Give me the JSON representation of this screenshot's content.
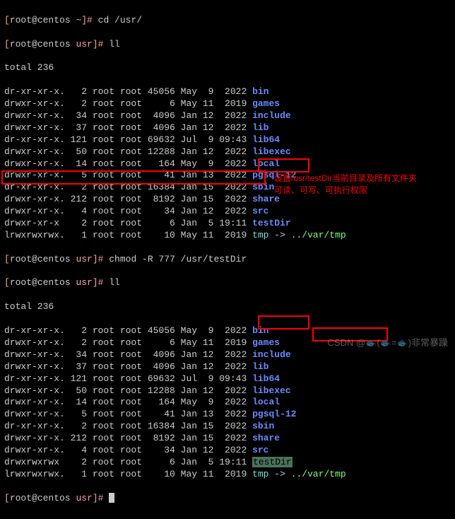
{
  "prompt1": {
    "br": "[",
    "user": "root@centos ",
    "path": "~",
    "br2": "]# ",
    "cmd": "cd /usr/"
  },
  "prompt2": {
    "br": "[",
    "user": "root@centos ",
    "path": "usr",
    "br2": "]# ",
    "cmd": "ll"
  },
  "total": "total 236",
  "ls1": [
    {
      "perm": "dr-xr-xr-x.",
      "l": "   2",
      "o": " root root",
      "s": " 45056",
      "d": " May  9  2022 ",
      "n": "bin",
      "cls": "dir"
    },
    {
      "perm": "drwxr-xr-x.",
      "l": "   2",
      "o": " root root",
      "s": "     6",
      "d": " May 11  2019 ",
      "n": "games",
      "cls": "dir"
    },
    {
      "perm": "drwxr-xr-x.",
      "l": "  34",
      "o": " root root",
      "s": "  4096",
      "d": " Jan 12  2022 ",
      "n": "include",
      "cls": "dir"
    },
    {
      "perm": "drwxr-xr-x.",
      "l": "  37",
      "o": " root root",
      "s": "  4096",
      "d": " Jan 12  2022 ",
      "n": "lib",
      "cls": "dir"
    },
    {
      "perm": "dr-xr-xr-x.",
      "l": " 121",
      "o": " root root",
      "s": " 69632",
      "d": " Jul  9 09:43 ",
      "n": "lib64",
      "cls": "dir"
    },
    {
      "perm": "drwxr-xr-x.",
      "l": "  50",
      "o": " root root",
      "s": " 12288",
      "d": " Jan 12  2022 ",
      "n": "libexec",
      "cls": "dir"
    },
    {
      "perm": "drwxr-xr-x.",
      "l": "  14",
      "o": " root root",
      "s": "   164",
      "d": " May  9  2022 ",
      "n": "local",
      "cls": "dir"
    },
    {
      "perm": "drwxr-xr-x.",
      "l": "   5",
      "o": " root root",
      "s": "    41",
      "d": " Jan 13  2022 ",
      "n": "pgsql-12",
      "cls": "dir"
    },
    {
      "perm": "dr-xr-xr-x.",
      "l": "   2",
      "o": " root root",
      "s": " 16384",
      "d": " Jan 15  2022 ",
      "n": "sbin",
      "cls": "dir"
    },
    {
      "perm": "drwxr-xr-x.",
      "l": " 212",
      "o": " root root",
      "s": "  8192",
      "d": " Jan 15  2022 ",
      "n": "share",
      "cls": "dir"
    },
    {
      "perm": "drwxr-xr-x.",
      "l": "   4",
      "o": " root root",
      "s": "    34",
      "d": " Jan 12  2022 ",
      "n": "src",
      "cls": "dir"
    },
    {
      "perm": "drwxr-xr-x ",
      "l": "   2",
      "o": " root root",
      "s": "     6",
      "d": " Jan  5 19:11 ",
      "n": "testDir",
      "cls": "dir"
    },
    {
      "perm": "lrwxrwxrwx.",
      "l": "   1",
      "o": " root root",
      "s": "    10",
      "d": " May 11  2019 ",
      "n": "tmp",
      "cls": "link",
      "arrow": " -> ",
      "tgt": "../var/tmp",
      "tcls": "exe"
    }
  ],
  "prompt3": {
    "br": "[",
    "user": "root@centos ",
    "path": "usr",
    "br2": "]# ",
    "cmd": "chmod -R 777 /usr/testDir"
  },
  "prompt4": {
    "br": "[",
    "user": "root@centos ",
    "path": "usr",
    "br2": "]# ",
    "cmd": "ll"
  },
  "total2": "total 236",
  "ls2": [
    {
      "perm": "dr-xr-xr-x.",
      "l": "   2",
      "o": " root root",
      "s": " 45056",
      "d": " May  9  2022 ",
      "n": "bin",
      "cls": "dir"
    },
    {
      "perm": "drwxr-xr-x.",
      "l": "   2",
      "o": " root root",
      "s": "     6",
      "d": " May 11  2019 ",
      "n": "games",
      "cls": "dir"
    },
    {
      "perm": "drwxr-xr-x.",
      "l": "  34",
      "o": " root root",
      "s": "  4096",
      "d": " Jan 12  2022 ",
      "n": "include",
      "cls": "dir"
    },
    {
      "perm": "drwxr-xr-x.",
      "l": "  37",
      "o": " root root",
      "s": "  4096",
      "d": " Jan 12  2022 ",
      "n": "lib",
      "cls": "dir"
    },
    {
      "perm": "dr-xr-xr-x.",
      "l": " 121",
      "o": " root root",
      "s": " 69632",
      "d": " Jul  9 09:43 ",
      "n": "lib64",
      "cls": "dir"
    },
    {
      "perm": "drwxr-xr-x.",
      "l": "  50",
      "o": " root root",
      "s": " 12288",
      "d": " Jan 12  2022 ",
      "n": "libexec",
      "cls": "dir"
    },
    {
      "perm": "drwxr-xr-x.",
      "l": "  14",
      "o": " root root",
      "s": "   164",
      "d": " May  9  2022 ",
      "n": "local",
      "cls": "dir"
    },
    {
      "perm": "drwxr-xr-x.",
      "l": "   5",
      "o": " root root",
      "s": "    41",
      "d": " Jan 13  2022 ",
      "n": "pgsql-12",
      "cls": "dir"
    },
    {
      "perm": "dr-xr-xr-x.",
      "l": "   2",
      "o": " root root",
      "s": " 16384",
      "d": " Jan 15  2022 ",
      "n": "sbin",
      "cls": "dir"
    },
    {
      "perm": "drwxr-xr-x.",
      "l": " 212",
      "o": " root root",
      "s": "  8192",
      "d": " Jan 15  2022 ",
      "n": "share",
      "cls": "dir"
    },
    {
      "perm": "drwxr-xr-x.",
      "l": "   4",
      "o": " root root",
      "s": "    34",
      "d": " Jan 12  2022 ",
      "n": "src",
      "cls": "dir"
    },
    {
      "perm": "drwxrwxrwx ",
      "l": "   2",
      "o": " root root",
      "s": "     6",
      "d": " Jan  5 19:11 ",
      "n": "testDir",
      "cls": "hl-testdir"
    },
    {
      "perm": "lrwxrwxrwx.",
      "l": "   1",
      "o": " root root",
      "s": "    10",
      "d": " May 11  2019 ",
      "n": "tmp",
      "cls": "link",
      "arrow": " -> ",
      "tgt": "../var/tmp",
      "tcls": "exe"
    }
  ],
  "prompt5": {
    "br": "[",
    "user": "root@centos ",
    "path": "usr",
    "br2": "]# ",
    "cmd": ""
  },
  "annotation_l1": "设置/usr/testDir当前目录及所有文件夹",
  "annotation_l2": "可读、可写、可执行权限",
  "watermark": "CSDN @🐟(🐟=🐟)非常暴躁"
}
